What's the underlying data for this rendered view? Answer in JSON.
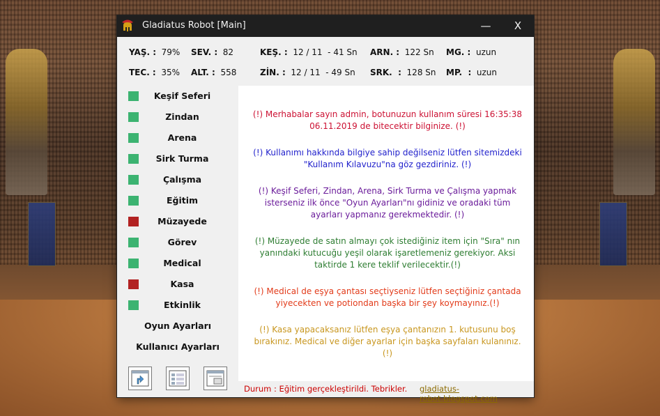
{
  "window": {
    "title": "Gladiatus Robot [Main]",
    "minimize": "—",
    "close": "X"
  },
  "stats": {
    "yas": {
      "label": "YAŞ. :",
      "value": "79%"
    },
    "sev": {
      "label": "SEV. :",
      "value": "82"
    },
    "kes": {
      "label": "KEŞ. :",
      "value": "12 / 11  - 41 Sn"
    },
    "arn": {
      "label": "ARN. :",
      "value": "122 Sn"
    },
    "mg": {
      "label": "MG. :",
      "value": "uzun"
    },
    "tec": {
      "label": "TEC. :",
      "value": "35%"
    },
    "alt": {
      "label": "ALT. :",
      "value": "558"
    },
    "zin": {
      "label": "ZİN. :",
      "value": "12 / 11  - 49 Sn"
    },
    "srk": {
      "label": "SRK.  :",
      "value": "128 Sn"
    },
    "mp": {
      "label": "MP.  :",
      "value": "uzun"
    }
  },
  "colors": {
    "on": "#3cb371",
    "off": "#b22222"
  },
  "menu": [
    {
      "label": "Keşif Seferi",
      "state": "on"
    },
    {
      "label": "Zindan",
      "state": "on"
    },
    {
      "label": "Arena",
      "state": "on"
    },
    {
      "label": "Sirk Turma",
      "state": "on"
    },
    {
      "label": "Çalışma",
      "state": "on"
    },
    {
      "label": "Eğitim",
      "state": "on"
    },
    {
      "label": "Müzayede",
      "state": "off"
    },
    {
      "label": "Görev",
      "state": "on"
    },
    {
      "label": "Medical",
      "state": "on"
    },
    {
      "label": "Kasa",
      "state": "off"
    },
    {
      "label": "Etkinlik",
      "state": "on"
    }
  ],
  "settings": {
    "game": "Oyun Ayarları",
    "user": "Kullanıcı Ayarları"
  },
  "toolbar_icons": [
    "export-window-icon",
    "list-view-icon",
    "document-window-icon"
  ],
  "messages": [
    {
      "text": "(!) Merhabalar sayın admin, botunuzun kullanım süresi 16:35:38 06.11.2019 de bitecektir bilginize. (!)",
      "color": "#cc1133"
    },
    {
      "text": "(!) Kullanımı hakkında bilgiye sahip değilseniz lütfen sitemizdeki \"Kullanım Kılavuzu\"na göz gezdiriniz. (!)",
      "color": "#2222cc"
    },
    {
      "text": "(!) Keşif Seferi, Zindan, Arena, Sirk Turma ve Çalışma yapmak isterseniz ilk önce \"Oyun Ayarları\"nı  gidiniz ve oradaki tüm ayarları yapmanız gerekmektedir. (!)",
      "color": "#6a1b9a"
    },
    {
      "text": "(!) Müzayede de satın almayı çok istediğiniz item için \"Sıra\" nın yanındaki kutucuğu yeşil olarak işaretlemeniz gerekiyor. Aksi taktirde 1 kere teklif verilecektir.(!)",
      "color": "#2e7d32"
    },
    {
      "text": "(!) Medical de eşya çantası seçtiyseniz lütfen seçtiğiniz çantada yiyecekten ve potiondan başka bir şey koymayınız.(!)",
      "color": "#e23b1a"
    },
    {
      "text": "(!) Kasa yapacaksanız lütfen eşya çantanızın 1. kutusunu boş bırakınız. Medical ve diğer ayarlar için başka sayfaları kulanınız.(!)",
      "color": "#c8961e"
    }
  ],
  "status": {
    "text": "Durum :  Eğitim gerçekleştirildi. Tebrikler.",
    "link": "gladiatus-robot.blogspot.com"
  }
}
